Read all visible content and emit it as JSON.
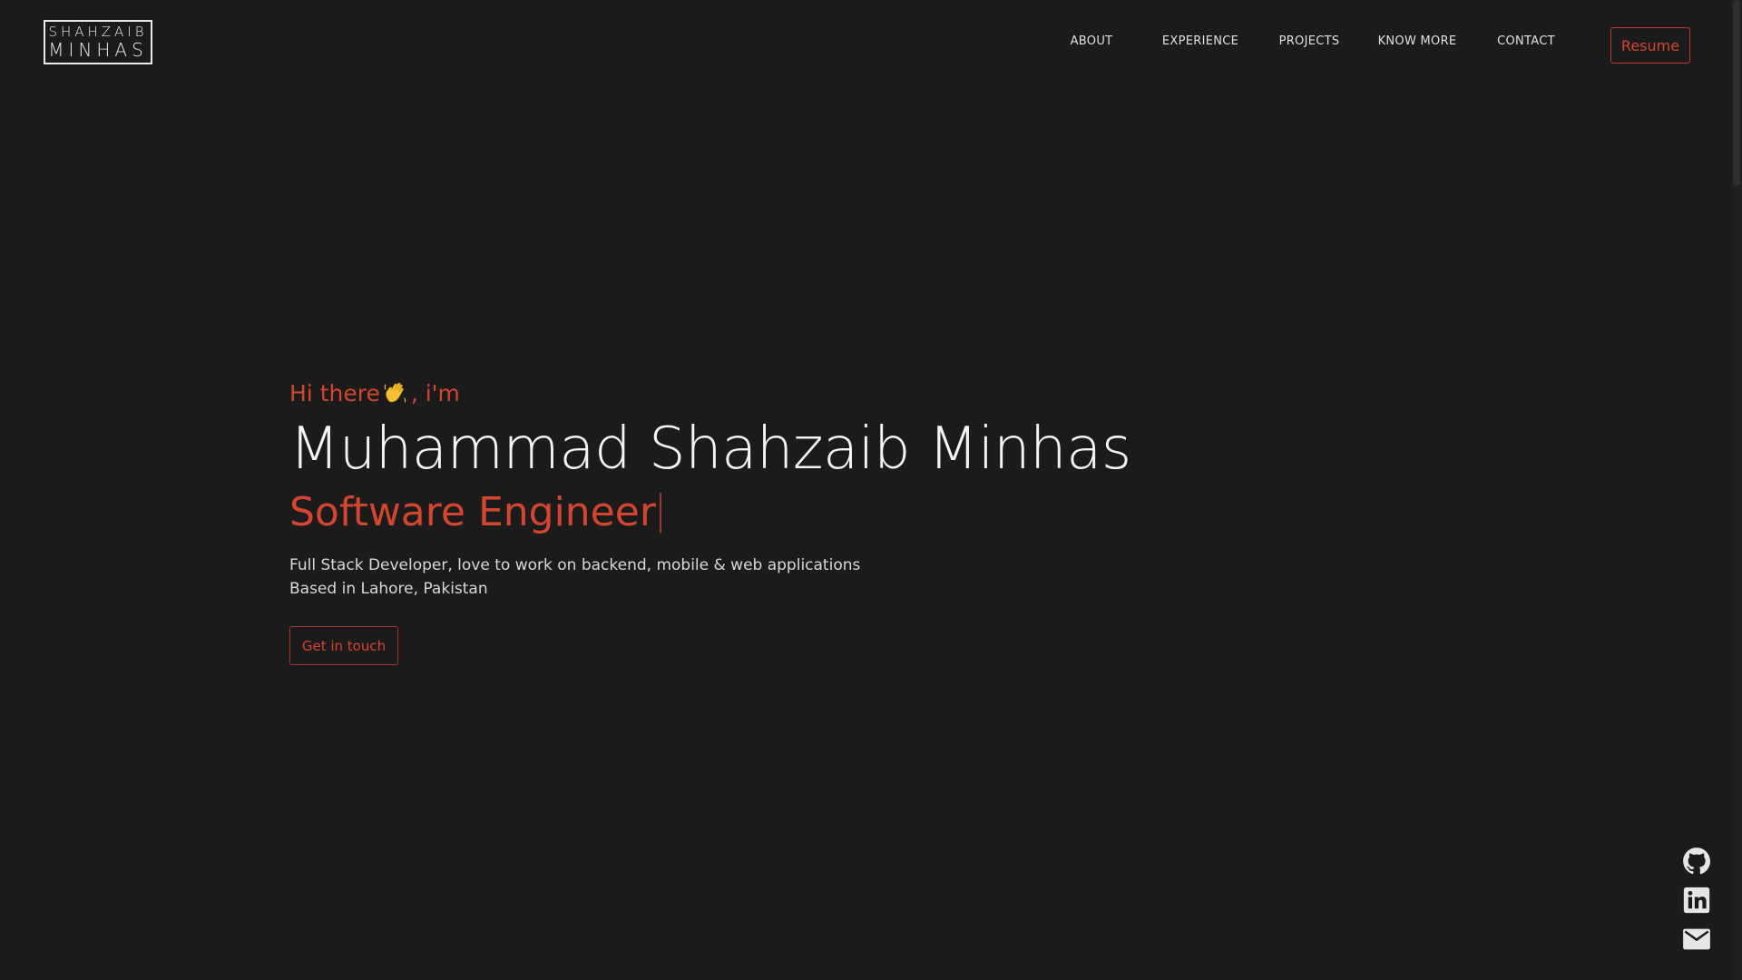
{
  "header": {
    "logo": {
      "line1": "SHAHZAIB",
      "line2": "MINHAS"
    },
    "nav": [
      {
        "label": "ABOUT"
      },
      {
        "label": "EXPERIENCE"
      },
      {
        "label": "PROJECTS"
      },
      {
        "label": "KNOW MORE"
      },
      {
        "label": "CONTACT"
      }
    ],
    "resume_label": "Resume"
  },
  "hero": {
    "greeting_before": "Hi there",
    "greeting_after": ", i'm",
    "wave_icon": "waving-hand-icon",
    "name": "Muhammad Shahzaib Minhas",
    "role": "Software Engineer",
    "description_line1": "Full Stack Developer, love to work on backend, mobile & web applications",
    "description_line2": "Based in Lahore, Pakistan",
    "cta_label": "Get in touch"
  },
  "social": [
    {
      "icon": "github-icon"
    },
    {
      "icon": "linkedin-icon"
    },
    {
      "icon": "email-icon"
    }
  ],
  "colors": {
    "background": "#1b1b1b",
    "accent": "#d3452f",
    "text": "#eaeaea"
  }
}
